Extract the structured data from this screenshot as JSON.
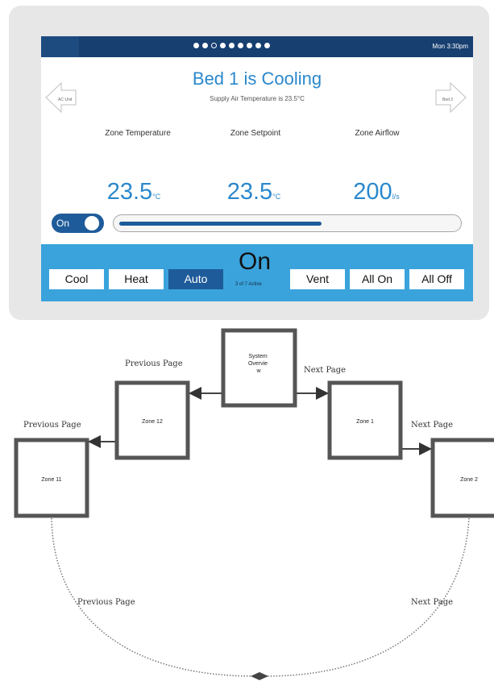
{
  "ui": {
    "clock": "Mon 3:30pm",
    "page_dots": [
      "filled",
      "filled",
      "ring",
      "filled",
      "filled",
      "filled",
      "filled",
      "filled",
      "filled"
    ],
    "title": "Bed 1 is Cooling",
    "subtitle": "Supply Air Temperature is 23.5°C",
    "prev_label": "AC Unit",
    "next_label": "Bed 2",
    "zone_temperature": {
      "label": "Zone Temperature",
      "value": "23.5",
      "unit": "°C"
    },
    "zone_setpoint": {
      "label": "Zone Setpoint",
      "value": "23.5",
      "unit": "°C"
    },
    "zone_airflow": {
      "label": "Zone Airflow",
      "value": "200",
      "unit": "l/s"
    },
    "toggle_label": "On",
    "setpoint_slider_fraction": 0.6,
    "modes": {
      "cool": "Cool",
      "heat": "Heat",
      "auto": "Auto",
      "vent": "Vent",
      "all_on": "All On",
      "all_off": "All Off"
    },
    "selected_mode": "Auto",
    "status": "On",
    "active_count": "3 of 7 Active"
  },
  "flow": {
    "nodes": {
      "overview": "System Overview",
      "zone1": "Zone 1",
      "zone2": "Zone 2",
      "zone11": "Zone 11",
      "zone12": "Zone 12"
    },
    "edges": {
      "overview_to_zone12": "Previous Page",
      "zone12_to_zone11": "Previous Page",
      "overview_to_zone1": "Next Page",
      "zone1_to_zone2": "Next Page",
      "zone11_loop": "Previous Page",
      "zone2_loop": "Next Page"
    }
  }
}
